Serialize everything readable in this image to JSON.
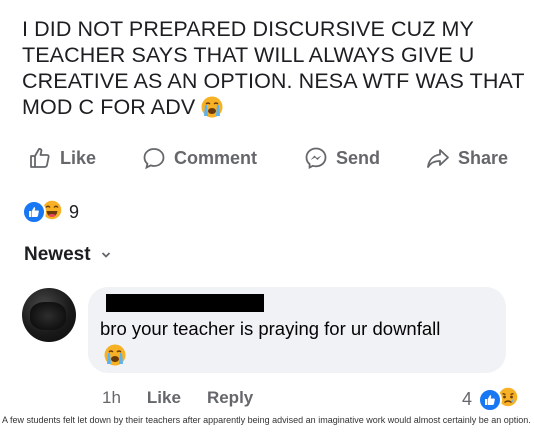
{
  "post": {
    "lines": [
      "I DID NOT PREPARED DISCURSIVE CUZ MY",
      "TEACHER SAYS THAT WILL ALWAYS GIVE U",
      "CREATIVE AS AN OPTION. NESA WTF WAS THAT",
      "MOD C FOR ADV"
    ],
    "trailing_emoji": "loudly-crying-face-emoji"
  },
  "actions": {
    "like": "Like",
    "comment": "Comment",
    "send": "Send",
    "share": "Share"
  },
  "reactions": {
    "types": [
      "like",
      "tears-of-joy"
    ],
    "count": "9"
  },
  "sort": {
    "label": "Newest"
  },
  "comment": {
    "author_redacted": true,
    "text": "bro your teacher is praying for ur downfall",
    "emoji": "loudly-crying-face-emoji",
    "time": "1h",
    "like_label": "Like",
    "reply_label": "Reply",
    "reaction_count": "4",
    "reaction_types": [
      "like",
      "sad"
    ]
  },
  "caption": "A few students felt let down by their teachers after apparently being advised an imaginative work would almost certainly be an option.",
  "colors": {
    "facebook_blue": "#1877f2",
    "action_grey": "#65676b",
    "bubble_bg": "#f0f2f5",
    "emoji_yellow": "#f7b125"
  }
}
